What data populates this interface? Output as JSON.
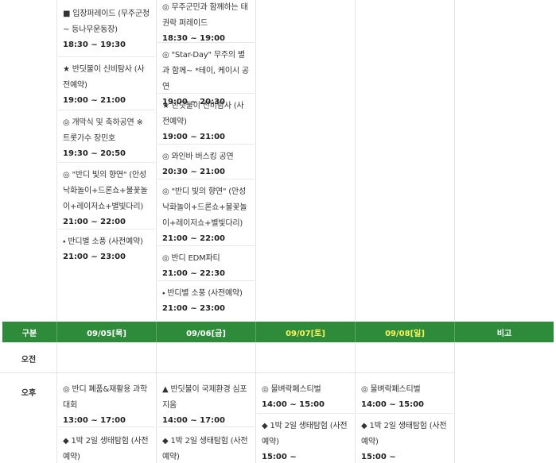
{
  "top_columns": [
    {
      "events": [
        {
          "title": "■ 입장퍼레이드 (무주군청 ~ 등나무운동장)",
          "time": "18:30 ~ 19:30"
        },
        {
          "title": "★ 반딧불이 신비탐사 (사전예약)",
          "time": "19:00 ~ 21:00"
        },
        {
          "title": "◎ 개막식 및 축하공연 ※ 트롯가수 장민호",
          "time": "19:30 ~ 20:50"
        },
        {
          "title": "◎ \"반디 빛의 향연\" (안성낙화놀이+드론쇼+불꽃놀이+레이저쇼+별빛다리)",
          "time": "21:00 ~ 22:00"
        },
        {
          "title": "⬩ 반디별 소풍 (사전예약)",
          "time": "21:00 ~ 23:00"
        }
      ]
    },
    {
      "events": [
        {
          "title": "◎ 무주군민과 함께하는 태권락 퍼레이드",
          "time": "18:30 ~ 19:00"
        },
        {
          "title": "◎ \"Star-Day\" 무주의 별과 함께~ *테이, 케이시 공연",
          "time": "19:00 ~ 20:30"
        },
        {
          "title": "★ 반딧불이 신비탐사 (사전예약)",
          "time": "19:00 ~ 21:00"
        },
        {
          "title": "◎ 와인바 버스킹 공연",
          "time": "20:30 ~ 21:00"
        },
        {
          "title": "◎ \"반디 빛의 향연\" (안성낙화놀이+드론쇼+불꽃놀이+레이저쇼+별빛다리)",
          "time": "21:00 ~ 22:00"
        },
        {
          "title": "◎ 반디 EDM파티",
          "time": "21:00 ~ 22:30"
        },
        {
          "title": "⬩ 반디별 소풍 (사전예약)",
          "time": "21:00 ~ 23:00"
        }
      ]
    }
  ],
  "header": {
    "gubun": "구분",
    "days": [
      {
        "label": "09/05[목]",
        "weekend": false
      },
      {
        "label": "09/06[금]",
        "weekend": false
      },
      {
        "label": "09/07[토]",
        "weekend": true
      },
      {
        "label": "09/08[일]",
        "weekend": true
      }
    ],
    "bigo": "비고"
  },
  "rows": {
    "morning": "오전",
    "afternoon": "오후"
  },
  "bottom_columns": [
    {
      "events": [
        {
          "title": "◎ 반디 폐품&재활용 과학대회",
          "time": "13:00 ~ 17:00"
        },
        {
          "title": "◆ 1박 2일 생태탐험 (사전예약)",
          "time": ""
        }
      ]
    },
    {
      "events": [
        {
          "title": "▲ 반딧불이 국제환경 심포지움",
          "time": "14:00 ~ 17:00"
        },
        {
          "title": "◆ 1박 2일 생태탐험 (사전예약)",
          "time": ""
        }
      ]
    },
    {
      "events": [
        {
          "title": "◎ 물벼락페스티벌",
          "time": "14:00 ~ 15:00"
        },
        {
          "title": "◆ 1박 2일 생태탐험 (사전예약)",
          "time": "15:00 ~"
        }
      ]
    },
    {
      "events": [
        {
          "title": "◎ 물벼락페스티벌",
          "time": "14:00 ~ 15:00"
        },
        {
          "title": "◆ 1박 2일 생태탐험 (사전예약)",
          "time": "15:00 ~"
        }
      ]
    }
  ]
}
